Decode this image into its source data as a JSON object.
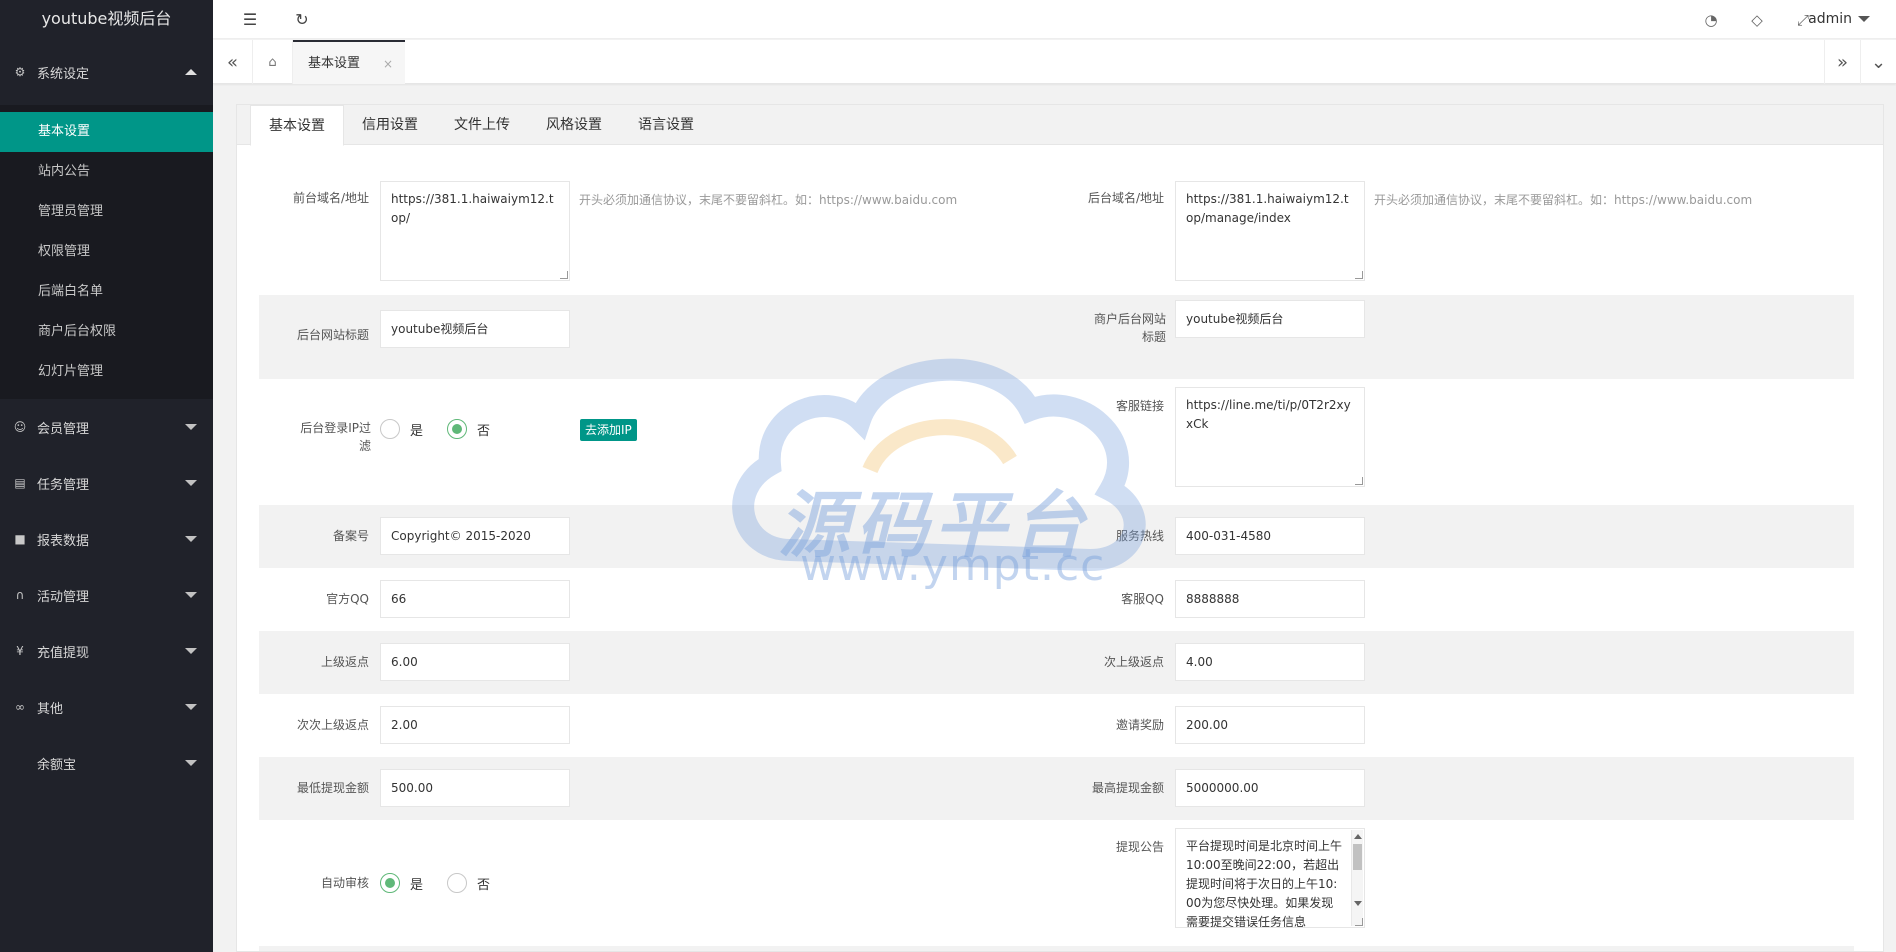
{
  "app": {
    "title": "youtube视频后台"
  },
  "sidebar": {
    "groups": [
      {
        "label": "系统设定",
        "icon": "gear-icon",
        "expanded": true
      },
      {
        "label": "会员管理",
        "icon": "user-icon"
      },
      {
        "label": "任务管理",
        "icon": "document-icon"
      },
      {
        "label": "报表数据",
        "icon": "chat-icon"
      },
      {
        "label": "活动管理",
        "icon": "headset-icon"
      },
      {
        "label": "充值提现",
        "icon": "yen-icon"
      },
      {
        "label": "其他",
        "icon": "link-icon"
      },
      {
        "label": "余额宝",
        "icon": ""
      }
    ],
    "sub_items": [
      "基本设置",
      "站内公告",
      "管理员管理",
      "权限管理",
      "后端白名单",
      "商户后台权限",
      "幻灯片管理"
    ]
  },
  "header": {
    "user": "admin",
    "icons": [
      "menu-fold-icon",
      "refresh-icon",
      "theme-icon",
      "tag-icon",
      "fullscreen-icon"
    ]
  },
  "tabbar": {
    "page_tab": "基本设置",
    "close": "×"
  },
  "form_tabs": [
    "基本设置",
    "信用设置",
    "文件上传",
    "风格设置",
    "语言设置"
  ],
  "form": {
    "front_domain": {
      "label": "前台域名/地址",
      "value": "https://381.1.haiwaiym12.top/",
      "hint": "开头必须加通信协议，末尾不要留斜杠。如：https://www.baidu.com"
    },
    "back_domain": {
      "label": "后台域名/地址",
      "value": "https://381.1.haiwaiym12.top/manage/index",
      "hint": "开头必须加通信协议，末尾不要留斜杠。如：https://www.baidu.com"
    },
    "admin_title": {
      "label": "后台网站标题",
      "value": "youtube视频后台"
    },
    "merchant_title": {
      "label": "商户后台网站标题",
      "value": "youtube视频后台"
    },
    "ip_filter": {
      "label": "后台登录IP过滤",
      "yes": "是",
      "no": "否",
      "selected": "否",
      "button": "去添加IP"
    },
    "service_link": {
      "label": "客服链接",
      "value": "https://line.me/ti/p/0T2r2xyxCk"
    },
    "icp": {
      "label": "备案号",
      "value": "Copyright© 2015-2020"
    },
    "hotline": {
      "label": "服务热线",
      "value": "400-031-4580"
    },
    "official_qq": {
      "label": "官方QQ",
      "value": "66"
    },
    "service_qq": {
      "label": "客服QQ",
      "value": "8888888"
    },
    "upper_rebate": {
      "label": "上级返点",
      "value": "6.00"
    },
    "second_rebate": {
      "label": "次上级返点",
      "value": "4.00"
    },
    "third_rebate": {
      "label": "次次上级返点",
      "value": "2.00"
    },
    "invite_reward": {
      "label": "邀请奖励",
      "value": "200.00"
    },
    "min_withdraw": {
      "label": "最低提现金额",
      "value": "500.00"
    },
    "max_withdraw": {
      "label": "最高提现金额",
      "value": "5000000.00"
    },
    "auto_audit": {
      "label": "自动审核",
      "yes": "是",
      "no": "否",
      "selected": "是"
    },
    "withdraw_notice": {
      "label": "提现公告",
      "value": "平台提现时间是北京时间上午10:00至晚间22:00，若超出提现时间将于次日的上午10:00为您尽快处理。如果发现需要提交错误任务信息"
    }
  },
  "watermark": {
    "text": "源码平台",
    "url": "www.ympt.cc"
  }
}
